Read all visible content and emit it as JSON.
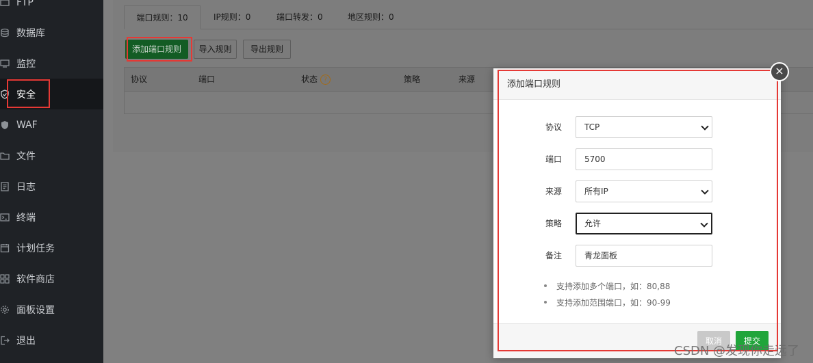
{
  "sidebar": {
    "items": [
      {
        "label": "FTP",
        "icon": "ftp-icon"
      },
      {
        "label": "数据库",
        "icon": "database-icon"
      },
      {
        "label": "监控",
        "icon": "monitor-icon"
      },
      {
        "label": "安全",
        "icon": "shield-icon"
      },
      {
        "label": "WAF",
        "icon": "waf-icon"
      },
      {
        "label": "文件",
        "icon": "folder-icon"
      },
      {
        "label": "日志",
        "icon": "log-icon"
      },
      {
        "label": "终端",
        "icon": "terminal-icon"
      },
      {
        "label": "计划任务",
        "icon": "clock-icon"
      },
      {
        "label": "软件商店",
        "icon": "grid-icon"
      },
      {
        "label": "面板设置",
        "icon": "gear-icon"
      },
      {
        "label": "退出",
        "icon": "logout-icon"
      }
    ],
    "active_index": 3
  },
  "main": {
    "tabs": [
      {
        "label": "端口规则：10"
      },
      {
        "label": "IP规则：0"
      },
      {
        "label": "端口转发：0"
      },
      {
        "label": "地区规则：0"
      }
    ],
    "toolbar": {
      "add_label": "添加端口规则",
      "import_label": "导入规则",
      "export_label": "导出规则"
    },
    "table": {
      "columns": [
        "协议",
        "端口",
        "状态",
        "策略",
        "来源"
      ],
      "help_glyph": "?"
    }
  },
  "dialog": {
    "title": "添加端口规则",
    "close_glyph": "×",
    "fields": {
      "protocol": {
        "label": "协议",
        "value": "TCP"
      },
      "port": {
        "label": "端口",
        "value": "5700"
      },
      "source": {
        "label": "来源",
        "value": "所有IP"
      },
      "policy": {
        "label": "策略",
        "value": "允许"
      },
      "remark": {
        "label": "备注",
        "value": "青龙面板"
      }
    },
    "tips": [
      "支持添加多个端口，如：80,88",
      "支持添加范围端口，如：90-99"
    ],
    "cancel_label": "取消",
    "submit_label": "提交"
  },
  "watermark": "CSDN @发现你走远了",
  "colors": {
    "annotation": "#e53935",
    "primary_green": "#20a53a",
    "sidebar_bg": "#1f2226"
  }
}
